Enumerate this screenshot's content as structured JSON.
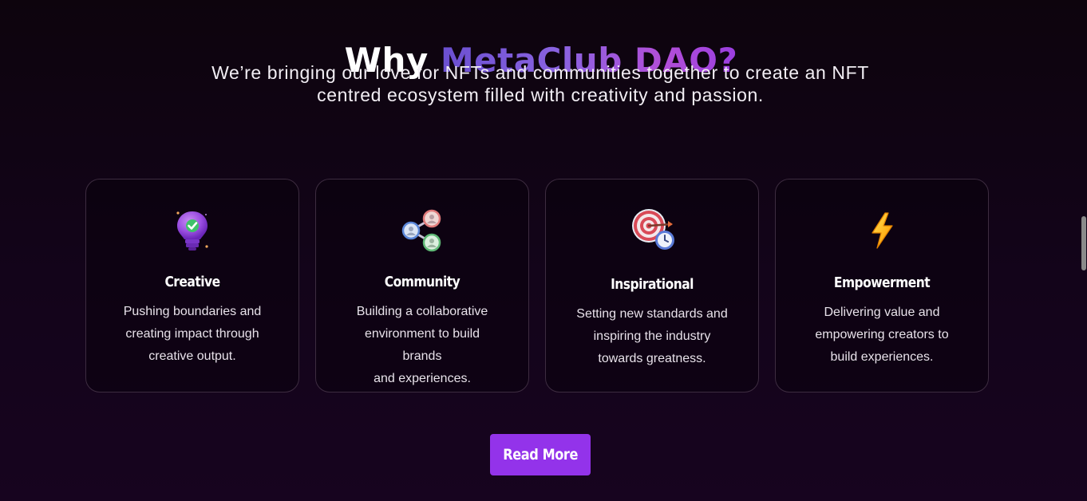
{
  "heading": {
    "prefix": "Why ",
    "brand": "MetaClub DAO?"
  },
  "subtitle": {
    "line1": "We’re bringing our love for NFTs and communities together to create an NFT",
    "line2": "centred ecosystem filled with creativity and passion."
  },
  "cards": [
    {
      "icon": "lightbulb-check-icon",
      "title": "Creative",
      "lines": [
        "Pushing boundaries and",
        "creating impact through",
        "creative output."
      ]
    },
    {
      "icon": "network-nodes-icon",
      "title": "Community",
      "lines": [
        "Building a collaborative",
        "environment to build brands",
        "and experiences."
      ]
    },
    {
      "icon": "target-clock-icon",
      "title": "Inspirational",
      "lines": [
        "Setting new standards and",
        "inspiring the industry",
        "towards greatness."
      ]
    },
    {
      "icon": "lightning-bolt-icon",
      "title": "Empowerment",
      "lines": [
        "Delivering value and",
        "empowering creators to",
        "build experiences."
      ]
    }
  ],
  "cta": {
    "label": "Read More"
  },
  "colors": {
    "accent": "#9333ea",
    "background": "#13041a",
    "card_border": "#3d2c40"
  }
}
